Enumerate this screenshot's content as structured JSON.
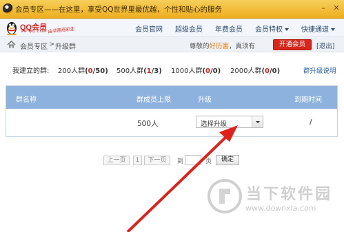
{
  "window": {
    "title": "会员专区——在这里，享受QQ世界里最优越，个性和贴心的服务",
    "controls": [
      "minimize-icon",
      "close-icon"
    ]
  },
  "logo": {
    "brand": "QQ会员",
    "domain": "VIP.QQ.COM",
    "slogan": "由华丽而彩生"
  },
  "nav": {
    "items": [
      "会员官网",
      "超级会员",
      "年费会员",
      "会员特权",
      "快捷通道"
    ]
  },
  "breadcrumb": {
    "root": "会员专区",
    "separator": ">",
    "current": "升级群"
  },
  "user": {
    "prefix": "尊敬的",
    "name": "好历害",
    "suffix": "，真须有",
    "open_button": "开通会员",
    "logout": "[退出]"
  },
  "summary": {
    "label": "我建立的群:",
    "groups": [
      {
        "size": "200人群",
        "used": "0",
        "total": "50"
      },
      {
        "size": "500人群",
        "used": "1",
        "total": "3"
      },
      {
        "size": "1000人群",
        "used": "0",
        "total": "0"
      },
      {
        "size": "2000人群",
        "used": "0",
        "total": "0"
      }
    ],
    "help_link": "群升级说明"
  },
  "table": {
    "headers": [
      "群名称",
      "群成员上限",
      "升级",
      "到期时间"
    ],
    "rows": [
      {
        "name": "",
        "limit": "500人",
        "upgrade": "选择升级",
        "expire": "/"
      }
    ]
  },
  "pager": {
    "prev": "上一页",
    "page": "1",
    "next": "下一页",
    "goto": "到",
    "unit": "页",
    "ok": "确定"
  },
  "watermark": {
    "title": "当下软件园",
    "url": "www.downxia.com"
  },
  "colors": {
    "titlebar": "#eeae1f",
    "table_header": "#8db2dd",
    "open_button": "#d7271b",
    "arrow": "#e0201a"
  }
}
